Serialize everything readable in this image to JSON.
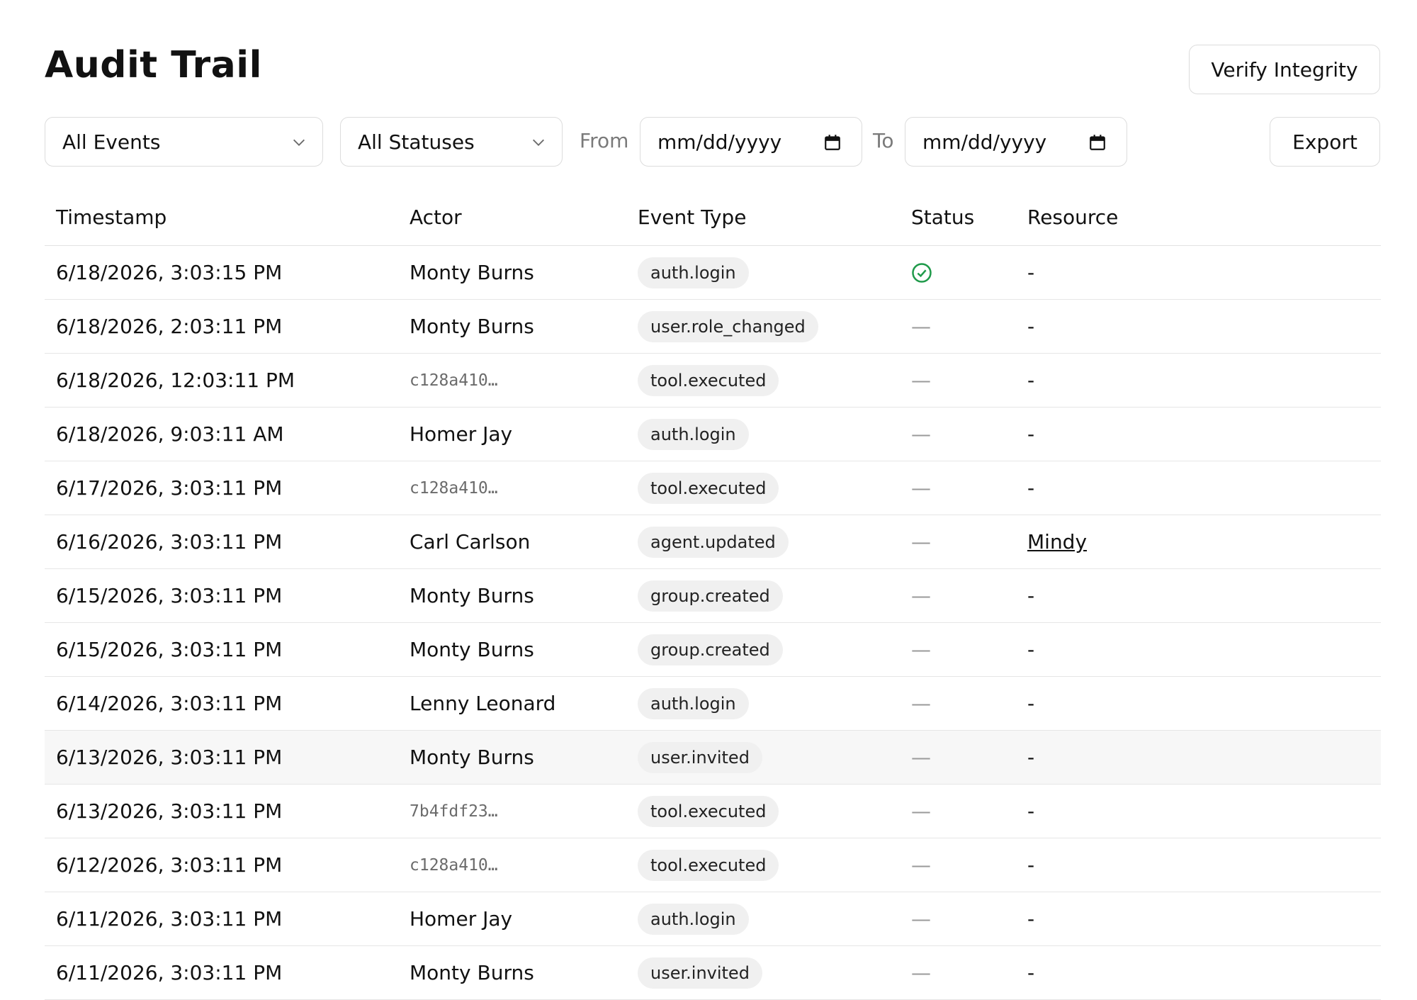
{
  "header": {
    "title": "Audit Trail",
    "verify_label": "Verify Integrity"
  },
  "filters": {
    "events_select": "All Events",
    "status_select": "All Statuses",
    "from_label": "From",
    "from_value": "mm/dd/yyyy",
    "to_label": "To",
    "to_value": "mm/dd/yyyy",
    "export_label": "Export"
  },
  "table": {
    "columns": [
      "Timestamp",
      "Actor",
      "Event Type",
      "Status",
      "Resource"
    ],
    "rows": [
      {
        "timestamp": "6/18/2026, 3:03:15 PM",
        "actor": "Monty Burns",
        "actor_id": false,
        "event": "auth.login",
        "status": "success",
        "resource": "-",
        "resource_link": false
      },
      {
        "timestamp": "6/18/2026, 2:03:11 PM",
        "actor": "Monty Burns",
        "actor_id": false,
        "event": "user.role_changed",
        "status": "—",
        "resource": "-",
        "resource_link": false
      },
      {
        "timestamp": "6/18/2026, 12:03:11 PM",
        "actor": "c128a410…",
        "actor_id": true,
        "event": "tool.executed",
        "status": "—",
        "resource": "-",
        "resource_link": false
      },
      {
        "timestamp": "6/18/2026, 9:03:11 AM",
        "actor": "Homer Jay",
        "actor_id": false,
        "event": "auth.login",
        "status": "—",
        "resource": "-",
        "resource_link": false
      },
      {
        "timestamp": "6/17/2026, 3:03:11 PM",
        "actor": "c128a410…",
        "actor_id": true,
        "event": "tool.executed",
        "status": "—",
        "resource": "-",
        "resource_link": false
      },
      {
        "timestamp": "6/16/2026, 3:03:11 PM",
        "actor": "Carl Carlson",
        "actor_id": false,
        "event": "agent.updated",
        "status": "—",
        "resource": "Mindy",
        "resource_link": true
      },
      {
        "timestamp": "6/15/2026, 3:03:11 PM",
        "actor": "Monty Burns",
        "actor_id": false,
        "event": "group.created",
        "status": "—",
        "resource": "-",
        "resource_link": false
      },
      {
        "timestamp": "6/15/2026, 3:03:11 PM",
        "actor": "Monty Burns",
        "actor_id": false,
        "event": "group.created",
        "status": "—",
        "resource": "-",
        "resource_link": false
      },
      {
        "timestamp": "6/14/2026, 3:03:11 PM",
        "actor": "Lenny Leonard",
        "actor_id": false,
        "event": "auth.login",
        "status": "—",
        "resource": "-",
        "resource_link": false
      },
      {
        "timestamp": "6/13/2026, 3:03:11 PM",
        "actor": "Monty Burns",
        "actor_id": false,
        "event": "user.invited",
        "status": "—",
        "resource": "-",
        "resource_link": false,
        "highlighted": true
      },
      {
        "timestamp": "6/13/2026, 3:03:11 PM",
        "actor": "7b4fdf23…",
        "actor_id": true,
        "event": "tool.executed",
        "status": "—",
        "resource": "-",
        "resource_link": false
      },
      {
        "timestamp": "6/12/2026, 3:03:11 PM",
        "actor": "c128a410…",
        "actor_id": true,
        "event": "tool.executed",
        "status": "—",
        "resource": "-",
        "resource_link": false
      },
      {
        "timestamp": "6/11/2026, 3:03:11 PM",
        "actor": "Homer Jay",
        "actor_id": false,
        "event": "auth.login",
        "status": "—",
        "resource": "-",
        "resource_link": false
      },
      {
        "timestamp": "6/11/2026, 3:03:11 PM",
        "actor": "Monty Burns",
        "actor_id": false,
        "event": "user.invited",
        "status": "—",
        "resource": "-",
        "resource_link": false
      }
    ]
  },
  "colors": {
    "success": "#1f9a4a",
    "border": "#dcdcdc",
    "chip_bg": "#f0f0f0"
  }
}
